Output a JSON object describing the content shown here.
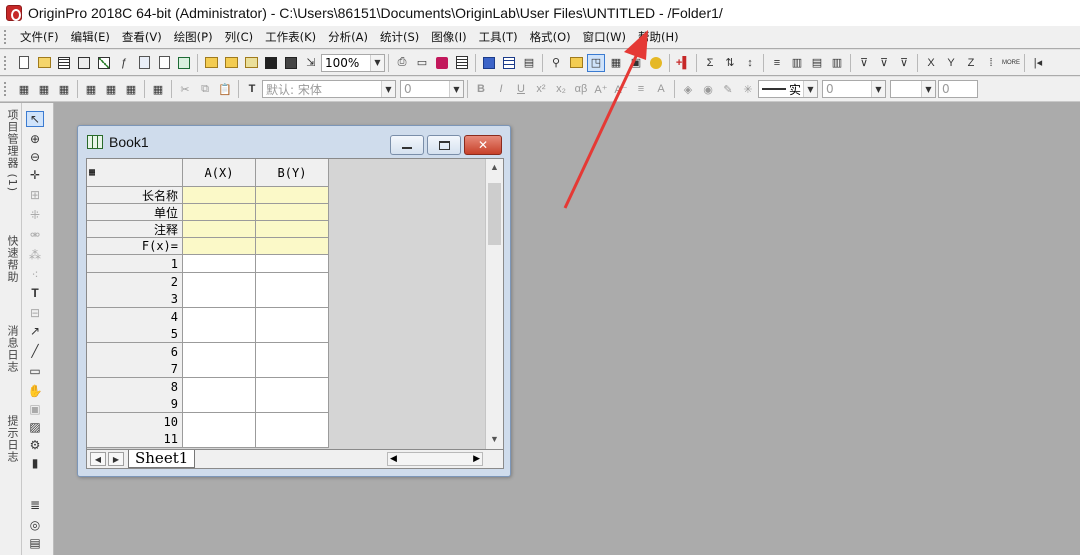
{
  "window": {
    "title": "OriginPro 2018C 64-bit (Administrator) - C:\\Users\\86151\\Documents\\OriginLab\\User Files\\UNTITLED - /Folder1/"
  },
  "menu": [
    "文件(F)",
    "编辑(E)",
    "查看(V)",
    "绘图(P)",
    "列(C)",
    "工作表(K)",
    "分析(A)",
    "统计(S)",
    "图像(I)",
    "工具(T)",
    "格式(O)",
    "窗口(W)",
    "帮助(H)"
  ],
  "toolbar1": {
    "zoom": "100%",
    "formula_label": "Σ",
    "x_label": "X",
    "y_label": "Y",
    "z_label": "Z"
  },
  "toolbar2": {
    "font": "默认: 宋体",
    "font_size": "0",
    "bold": "B",
    "italic": "I",
    "underline": "U",
    "line_style": "实",
    "line_width": "0",
    "fill_value": "0"
  },
  "side_tabs": [
    "项目管理器 (1)",
    "快速帮助",
    "消息日志",
    "提示日志"
  ],
  "book": {
    "title": "Book1",
    "col_a": "A(X)",
    "col_b": "B(Y)",
    "label_rows": [
      "长名称",
      "单位",
      "注释",
      "F(x)="
    ],
    "rows": [
      "1",
      "2",
      "3",
      "4",
      "5",
      "6",
      "7",
      "8",
      "9",
      "10",
      "11"
    ],
    "sheet_tab": "Sheet1"
  },
  "colors": {
    "annotation_arrow": "#e53935",
    "workspace": "#ababab"
  }
}
